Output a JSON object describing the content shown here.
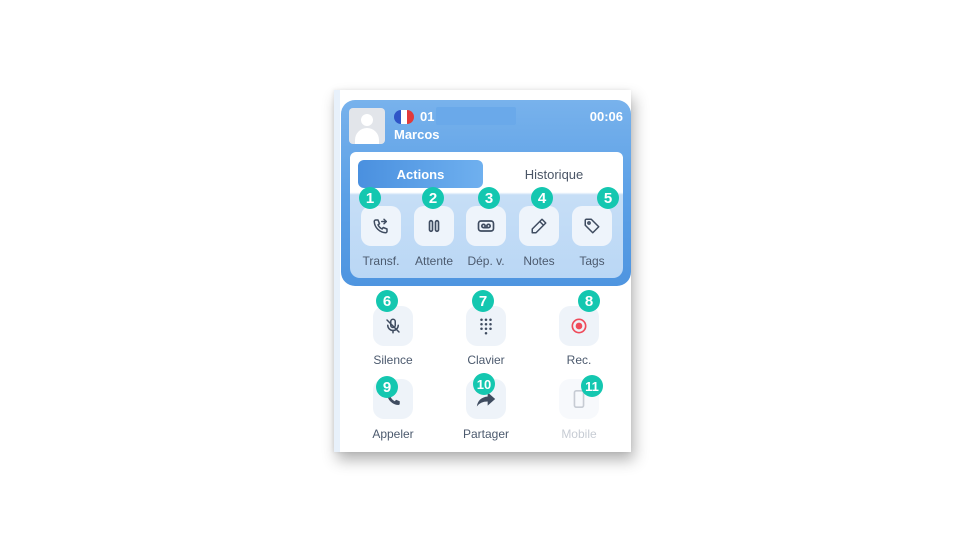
{
  "call": {
    "number_prefix": "01",
    "caller_name": "Marcos",
    "duration": "00:06",
    "flag_colors": [
      "#2f55c7",
      "#ffffff",
      "#e23a3a"
    ]
  },
  "tabs": [
    {
      "label": "Actions",
      "active": true
    },
    {
      "label": "Historique",
      "active": false
    }
  ],
  "actions": [
    {
      "badge": "1",
      "label": "Transf.",
      "icon": "phone-transfer-icon"
    },
    {
      "badge": "2",
      "label": "Attente",
      "icon": "pause-icon"
    },
    {
      "badge": "3",
      "label": "Dép. v.",
      "icon": "voicemail-icon"
    },
    {
      "badge": "4",
      "label": "Notes",
      "icon": "pencil-icon"
    },
    {
      "badge": "5",
      "label": "Tags",
      "icon": "tag-icon"
    }
  ],
  "controls": [
    {
      "badge": "6",
      "label": "Silence",
      "icon": "microphone-off-icon",
      "enabled": true
    },
    {
      "badge": "7",
      "label": "Clavier",
      "icon": "dialpad-icon",
      "enabled": true
    },
    {
      "badge": "8",
      "label": "Rec.",
      "icon": "record-icon",
      "enabled": true
    },
    {
      "badge": "9",
      "label": "Appeler",
      "icon": "phone-call-icon",
      "enabled": true
    },
    {
      "badge": "10",
      "label": "Partager",
      "icon": "share-icon",
      "enabled": true
    },
    {
      "badge": "11",
      "label": "Mobile",
      "icon": "mobile-phone-icon",
      "enabled": false
    }
  ],
  "colors": {
    "accent": "#4a90df",
    "badge": "#14c7b0",
    "record": "#ef4b5b"
  }
}
